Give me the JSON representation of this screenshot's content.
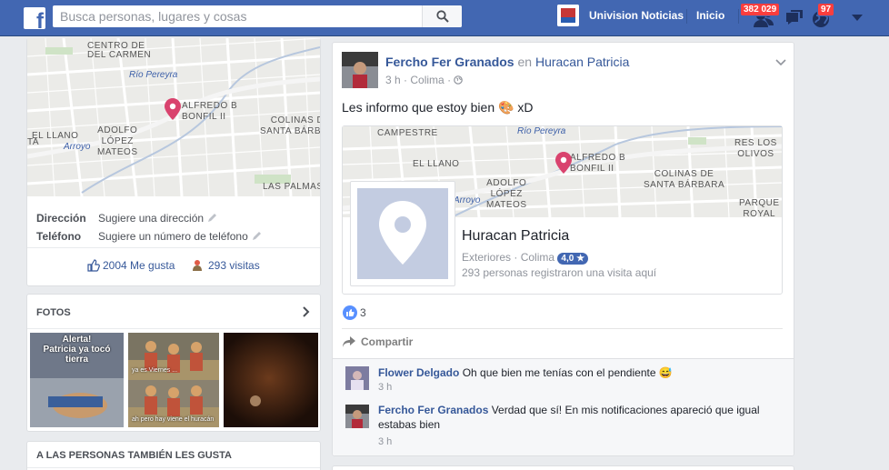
{
  "topbar": {
    "logo": "f",
    "search_placeholder": "Busca personas, lugares y cosas",
    "page_name": "Univision Noticias",
    "home": "Inicio",
    "friend_requests_badge": "382 029",
    "notifications_badge": "97",
    "icons": [
      "search-icon",
      "friends-icon",
      "messages-icon",
      "globe-icon",
      "caret-down-icon"
    ]
  },
  "left": {
    "map_labels": {
      "del_carmen": "DEL CARMEN",
      "rio_pereyra": "Río Pereyra",
      "alfredo": "ALFREDO B\nBONFIL II",
      "el_llano": "EL LLANO",
      "adolfo": "ADOLFO\nLÓPEZ\nMATEOS",
      "colinas": "COLINAS DE\nSANTA BÁRBARA",
      "arroyo": "Arroyo",
      "las_palmas": "LAS PALMAS",
      "ta": "TA",
      "top": "CENTRO DE"
    },
    "direccion_label": "Dirección",
    "direccion_value": "Sugiere una dirección",
    "telefono_label": "Teléfono",
    "telefono_value": "Sugiere un número de teléfono",
    "likes": "2004 Me gusta",
    "visits": "293 visitas",
    "fotos_title": "FOTOS",
    "photo1_caption": "Alerta!\nPatricia ya tocó\ntierra",
    "photo2_caption_a": "ya es Viernes ...",
    "photo2_caption_b": "ah pero hay viene el huracán",
    "likes_section_title": "A LAS PERSONAS TAMBIÉN LES GUSTA"
  },
  "post": {
    "author": "Fercho Fer Granados",
    "connector": "en",
    "place": "Huracan Patricia",
    "time": "3 h",
    "dot": "·",
    "location": "Colima",
    "text_before": "Les informo que estoy bien",
    "emoji": "🎨",
    "text_after": "xD",
    "map_labels": {
      "campestre": "CAMPESTRE",
      "rio_pereyra": "Río Pereyra",
      "alfredo": "ALFREDO B\nBONFIL II",
      "res_los_olivos": "RES LOS\nOLIVOS",
      "el_llano": "EL LLANO",
      "colinas": "COLINAS DE\nSANTA BÁRBARA",
      "adolfo": "ADOLFO\nLÓPEZ\nMATEOS",
      "arroyo": "Arroyo",
      "parque_royal": "PARQUE\nROYAL"
    },
    "place_card": {
      "name": "Huracan Patricia",
      "category": "Exteriores",
      "city": "Colima",
      "rating": "4,0 ★",
      "visits": "293 personas registraron una visita aquí"
    },
    "reactions_count": "3",
    "share_label": "Compartir"
  },
  "comments": [
    {
      "name": "Flower Delgado",
      "text": "Oh que bien me tenías con el pendiente",
      "emoji": "😅",
      "time": "3 h"
    },
    {
      "name": "Fercho Fer Granados",
      "text": "Verdad que sí! En mis notificaciones apareció que igual estabas bien",
      "time": "3 h"
    }
  ],
  "colors": {
    "brand": "#4267b2",
    "link": "#365899",
    "badge": "#fa3e3e",
    "pin": "#d9436e"
  }
}
